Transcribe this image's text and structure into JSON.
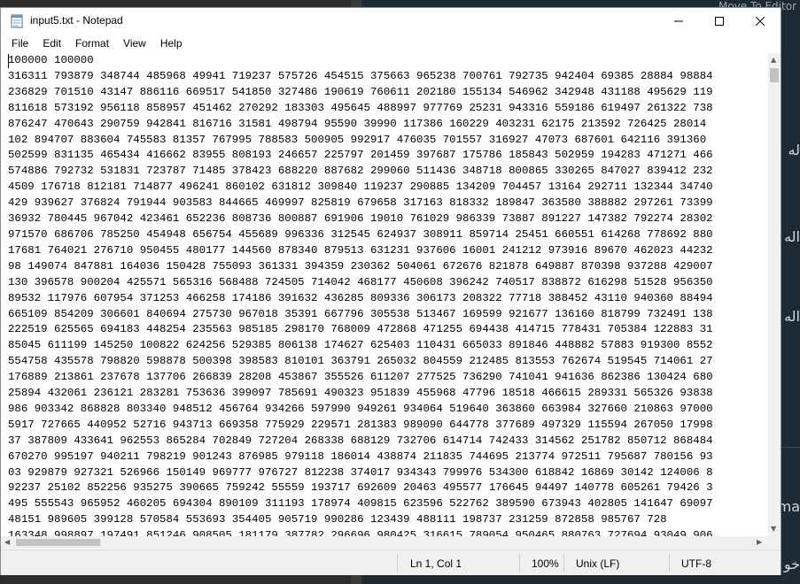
{
  "background": {
    "right_header_text": "Move To Editor",
    "arabic_fragments": [
      "له",
      "اله",
      "اله",
      "ma",
      "خو"
    ]
  },
  "window": {
    "title": "input5.txt - Notepad",
    "controls": {
      "minimize": "—",
      "maximize": "☐",
      "close": "✕"
    }
  },
  "menu": [
    "File",
    "Edit",
    "Format",
    "View",
    "Help"
  ],
  "editor": {
    "lines": [
      "100000 100000",
      "316311 793879 348744 485968 49941 719237 575726 454515 375663 965238 700761 792735 942404 69385 28884 98884",
      "236829 701510 43147 886116 669517 541850 327486 190619 760611 202180 155134 546962 342948 431188 495629 119",
      "811618 573192 956118 858957 451462 270292 183303 495645 488997 977769 25231 943316 559186 619497 261322 738",
      "876247 470643 290759 942841 816716 31581 498794 95590 39990 117386 160229 403231 62175 213592 726425 28014",
      "102 894707 883604 745583 81357 767995 788583 500905 992917 476035 701557 316927 47073 687601 642116 391360",
      "502599 831135 465434 416662 83955 808193 246657 225797 201459 397687 175786 185843 502959 194283 471271 466",
      "574886 792732 531831 723787 71485 378423 688220 887682 299060 511436 348718 800865 330265 847027 839412 232",
      "4509 176718 812181 714877 496241 860102 631812 309840 119237 290885 134209 704457 13164 292711 132344 34740",
      "429 939627 376824 791944 903583 844665 469997 825819 679658 317163 818332 189847 363580 388882 297261 73399",
      "36932 780445 967042 423461 652236 808736 800887 691906 19010 761029 986339 73887 891227 147382 792274 28302",
      "971570 686706 785250 454948 656754 455689 996336 312545 624937 308911 859714 25451 660551 614268 778692 880",
      "17681 764021 276710 950455 480177 144560 878340 879513 631231 937606 16001 241212 973916 89670 462023 44232",
      "98 149074 847881 164036 150428 755093 361331 394359 230362 504061 672676 821878 649887 870398 937288 429007",
      "130 396578 900204 425571 565316 568488 724505 714042 468177 450608 396242 740517 838872 616298 51528 956350",
      "89532 117976 607954 371253 466258 174186 391632 436285 809336 306173 208322 77718 388452 43110 940360 88494",
      "665109 854209 306601 840694 275730 967018 35391 667796 305538 513467 169599 921677 136160 818799 732491 138",
      "222519 625565 694183 448254 235563 985185 298170 768009 472868 471255 694438 414715 778431 705384 122883 31",
      "85045 611199 145250 100822 624256 529385 806138 174627 625403 110431 665033 891846 448882 57883 919300 8552",
      "554758 435578 798820 598878 500398 398583 810101 363791 265032 804559 212485 813553 762674 519545 714061 27",
      "176889 213861 237678 137706 266839 28208 453867 355526 611207 277525 736290 741041 941636 862386 130424 680",
      "25894 432061 236121 283281 753636 399097 785691 490323 951839 455968 47796 18518 466615 289331 565326 93838",
      "986 903342 868828 803340 948512 456764 934266 597990 949261 934064 519640 363860 663984 327660 210863 97000",
      "5917 727665 440952 52716 943713 669358 775929 229571 281383 989090 644778 377689 497329 115594 267050 17998",
      "37 387809 433641 962553 865284 702849 727204 268338 688129 732706 614714 742433 314562 251782 850712 868484",
      "670270 995197 940211 798219 901243 876985 979118 186014 438874 211835 744695 213774 972511 795687 780156 93",
      "03 929879 927321 526966 150149 969777 976727 812238 374017 934343 799976 534300 618842 16869 30142 124006 8",
      "92237 25102 852256 935275 390665 759242 55559 193717 692609 20463 495577 176645 94497 140778 605261 79426 3",
      "495 555543 965952 460205 694304 890109 311193 178974 409815 623596 522762 389590 673943 402805 141647 69097",
      "48151 989605 399128 570584 553693 354405 905719 990286 123439 488111 198737 231259 872858 985767 728",
      "163348 998897 197491 851246 908505 181179 387782 296696 980425 316615 789054 950465 880763 727694 93049 906"
    ]
  },
  "status": {
    "position": "Ln 1, Col 1",
    "zoom": "100%",
    "line_ending": "Unix (LF)",
    "encoding": "UTF-8"
  },
  "colors": {
    "window_bg": "#ffffff",
    "statusbar_bg": "#f0f0f0",
    "desktop_bg": "#1e2a33"
  }
}
